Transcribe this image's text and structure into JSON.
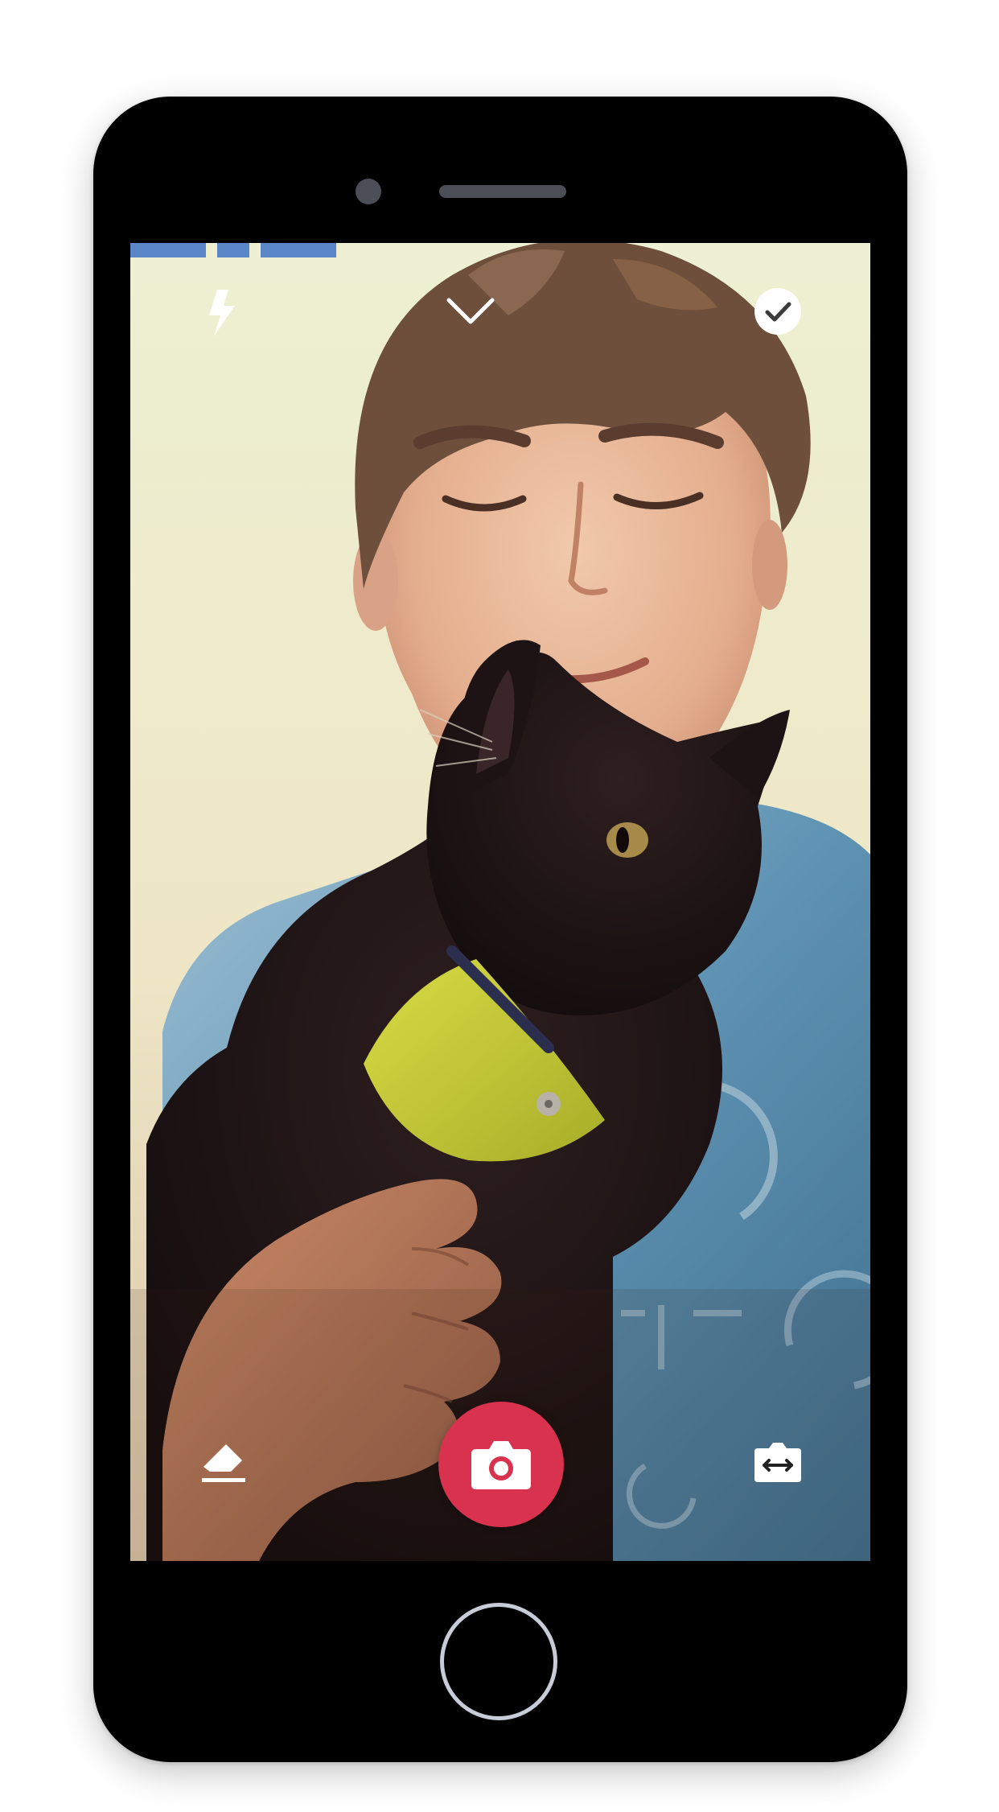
{
  "device": {
    "frame_color": "#000000",
    "home_button_color": "#c7ccd8"
  },
  "photo": {
    "subject": "person-holding-black-cat-photo",
    "background_color": "#efe9c8"
  },
  "story_progress": {
    "segment_count": 3,
    "color": "#5b86c8"
  },
  "top_bar": {
    "flash_icon": "lightning-bolt-icon",
    "collapse_icon": "chevron-down-icon",
    "done_icon": "check-circle-icon"
  },
  "bottom_bar": {
    "eraser_icon": "eraser-icon",
    "shutter_icon": "camera-icon",
    "shutter_color": "#d8324e",
    "flip_icon": "switch-camera-icon"
  }
}
